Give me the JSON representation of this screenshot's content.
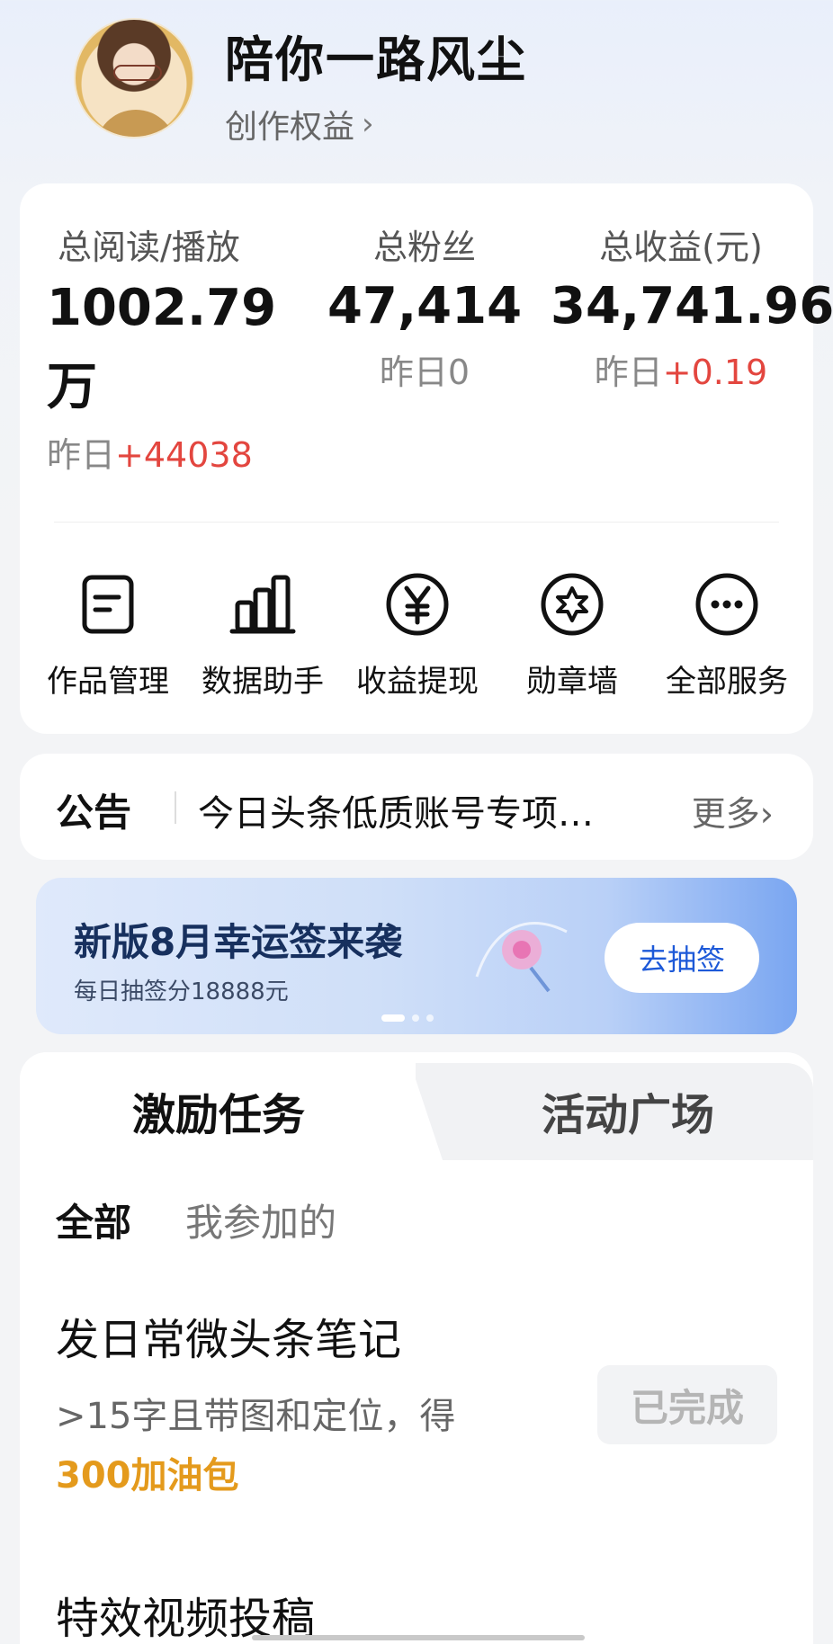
{
  "header": {
    "username": "陪你一路风尘",
    "rights_label": "创作权益",
    "rights_chevron": "›"
  },
  "stats": {
    "reads": {
      "label": "总阅读/播放",
      "value": "1002.79",
      "unit": "万",
      "yesterday_prefix": "昨日",
      "yesterday_value": "+44038"
    },
    "fans": {
      "label": "总粉丝",
      "value": "47,414",
      "yesterday_prefix": "昨日",
      "yesterday_value": "0"
    },
    "income": {
      "label": "总收益(元)",
      "value": "34,741.96",
      "yesterday_prefix": "昨日",
      "yesterday_value": "+0.19"
    }
  },
  "tools": [
    {
      "label": "作品管理",
      "icon": "document-icon"
    },
    {
      "label": "数据助手",
      "icon": "bar-chart-icon"
    },
    {
      "label": "收益提现",
      "icon": "yen-icon"
    },
    {
      "label": "勋章墙",
      "icon": "badge-icon"
    },
    {
      "label": "全部服务",
      "icon": "more-icon"
    }
  ],
  "notice": {
    "title": "公告",
    "text": "今日头条低质账号专项…",
    "more": "更多",
    "more_chevron": "›"
  },
  "banner": {
    "title": "新版8月幸运签来袭",
    "subtitle": "每日抽签分18888元",
    "button": "去抽签"
  },
  "tasks": {
    "tabs": [
      "激励任务",
      "活动广场"
    ],
    "subtabs": [
      "全部",
      "我参加的"
    ],
    "items": [
      {
        "title": "发日常微头条笔记",
        "desc": ">15字且带图和定位，得",
        "reward": "300加油包",
        "status": "已完成"
      },
      {
        "title": "特效视频投稿"
      }
    ]
  },
  "colors": {
    "accent_red": "#e3463f",
    "reward_orange": "#e49a1c",
    "button_blue": "#1d59d8"
  }
}
